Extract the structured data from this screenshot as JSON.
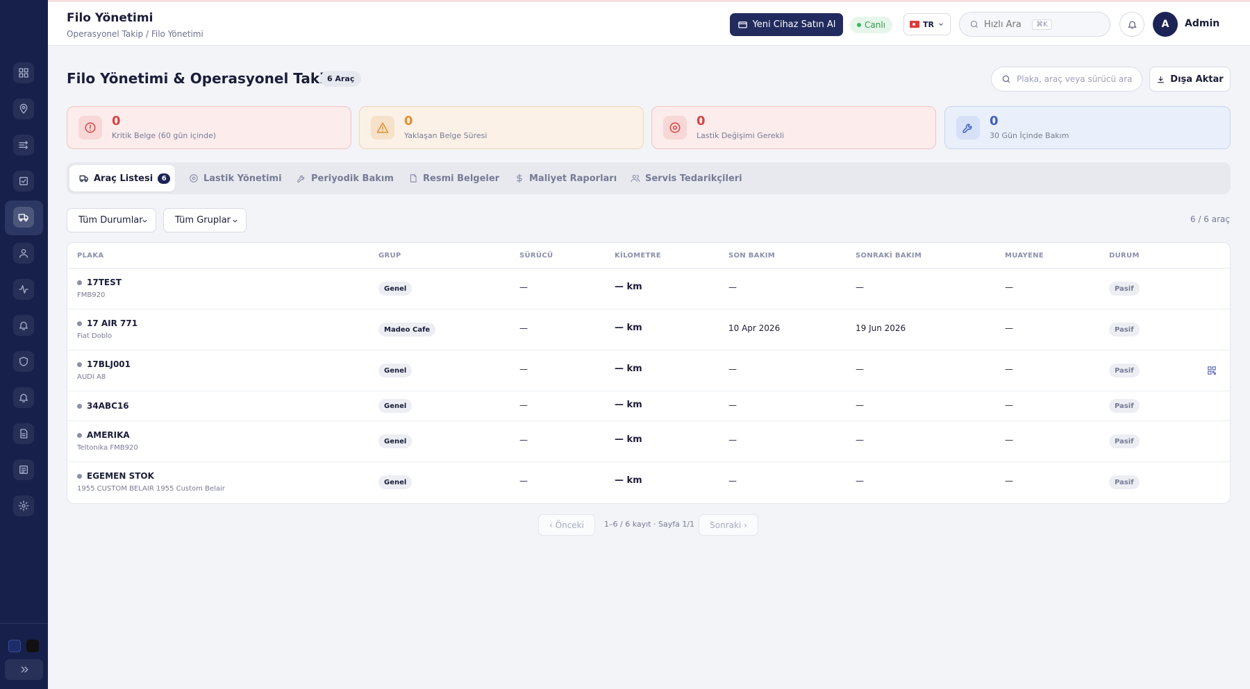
{
  "header": {
    "title": "Filo Yönetimi",
    "breadcrumb": "Operasyonel Takip / Filo Yönetimi",
    "buy_button": "Yeni Cihaz Satın Al",
    "live_label": "Canlı",
    "language": "TR",
    "search_placeholder": "Hızlı Ara",
    "search_shortcut": "⌘K",
    "avatar_initial": "A",
    "user_name": "Admin"
  },
  "sidebar": {
    "icons": [
      "dashboard-icon",
      "location-pin-icon",
      "routes-icon",
      "tasks-icon",
      "fleet-truck-icon",
      "user-icon",
      "activity-icon",
      "bell-icon",
      "shield-icon",
      "alarm-icon",
      "document-icon",
      "report-icon",
      "settings-icon"
    ],
    "active": "fleet-truck-icon",
    "swatch_colors": [
      "#1d2d6b",
      "#111111"
    ]
  },
  "page": {
    "title": "Filo Yönetimi & Operasyonel Takip",
    "vehicle_badge": "6 Araç",
    "search_placeholder": "Plaka, araç veya sürücü ara",
    "export_label": "Dışa Aktar"
  },
  "stats": [
    {
      "value": "0",
      "label": "Kritik Belge (60 gün içinde)",
      "icon": "alert-circle-icon",
      "color": "#d64545"
    },
    {
      "value": "0",
      "label": "Yaklaşan Belge Süresi",
      "icon": "warning-triangle-icon",
      "color": "#e0902e"
    },
    {
      "value": "0",
      "label": "Lastik Değişimi Gerekli",
      "icon": "tire-target-icon",
      "color": "#d64545"
    },
    {
      "value": "0",
      "label": "30 Gün İçinde Bakım",
      "icon": "wrench-icon",
      "color": "#3f5fc4"
    }
  ],
  "tabs": [
    {
      "label": "Araç Listesi",
      "count": "6",
      "icon": "truck-icon"
    },
    {
      "label": "Lastik Yönetimi",
      "icon": "tire-icon"
    },
    {
      "label": "Periyodik Bakım",
      "icon": "wrench-icon"
    },
    {
      "label": "Resmi Belgeler",
      "icon": "file-icon"
    },
    {
      "label": "Maliyet Raporları",
      "icon": "dollar-icon"
    },
    {
      "label": "Servis Tedarikçileri",
      "icon": "users-icon"
    }
  ],
  "filters": {
    "status": "Tüm Durumlar",
    "group": "Tüm Gruplar",
    "vehicle_count": "6 / 6 araç"
  },
  "table": {
    "headers": [
      "PLAKA",
      "GRUP",
      "SÜRÜCÜ",
      "KİLOMETRE",
      "SON BAKIM",
      "SONRAKİ BAKIM",
      "MUAYENE",
      "DURUM"
    ],
    "rows": [
      {
        "plate": "17TEST",
        "model": "FMB920",
        "group": "Genel",
        "driver": "—",
        "km": "— km",
        "last": "—",
        "next": "—",
        "inspection": "—",
        "status": "Pasif"
      },
      {
        "plate": "17 AIR 771",
        "model": "Fiat Doblo",
        "group": "Madeo Cafe",
        "driver": "—",
        "km": "— km",
        "last": "10 Apr 2026",
        "next": "19 Jun 2026",
        "inspection": "—",
        "status": "Pasif"
      },
      {
        "plate": "17BLJ001",
        "model": "AUDI A8",
        "group": "Genel",
        "driver": "—",
        "km": "— km",
        "last": "—",
        "next": "—",
        "inspection": "—",
        "status": "Pasif"
      },
      {
        "plate": "34ABC16",
        "model": "",
        "group": "Genel",
        "driver": "—",
        "km": "— km",
        "last": "—",
        "next": "—",
        "inspection": "—",
        "status": "Pasif"
      },
      {
        "plate": "AMERIKA",
        "model": "Teltonika FMB920",
        "group": "Genel",
        "driver": "—",
        "km": "— km",
        "last": "—",
        "next": "—",
        "inspection": "—",
        "status": "Pasif"
      },
      {
        "plate": "EGEMEN STOK",
        "model": "1955 CUSTOM BELAIR 1955 Custom Belair",
        "group": "Genel",
        "driver": "—",
        "km": "— km",
        "last": "—",
        "next": "—",
        "inspection": "—",
        "status": "Pasif"
      }
    ]
  },
  "pagination": {
    "prev": "‹ Önceki",
    "info": "1–6 / 6 kayıt · Sayfa 1/1",
    "next": "Sonraki ›"
  }
}
